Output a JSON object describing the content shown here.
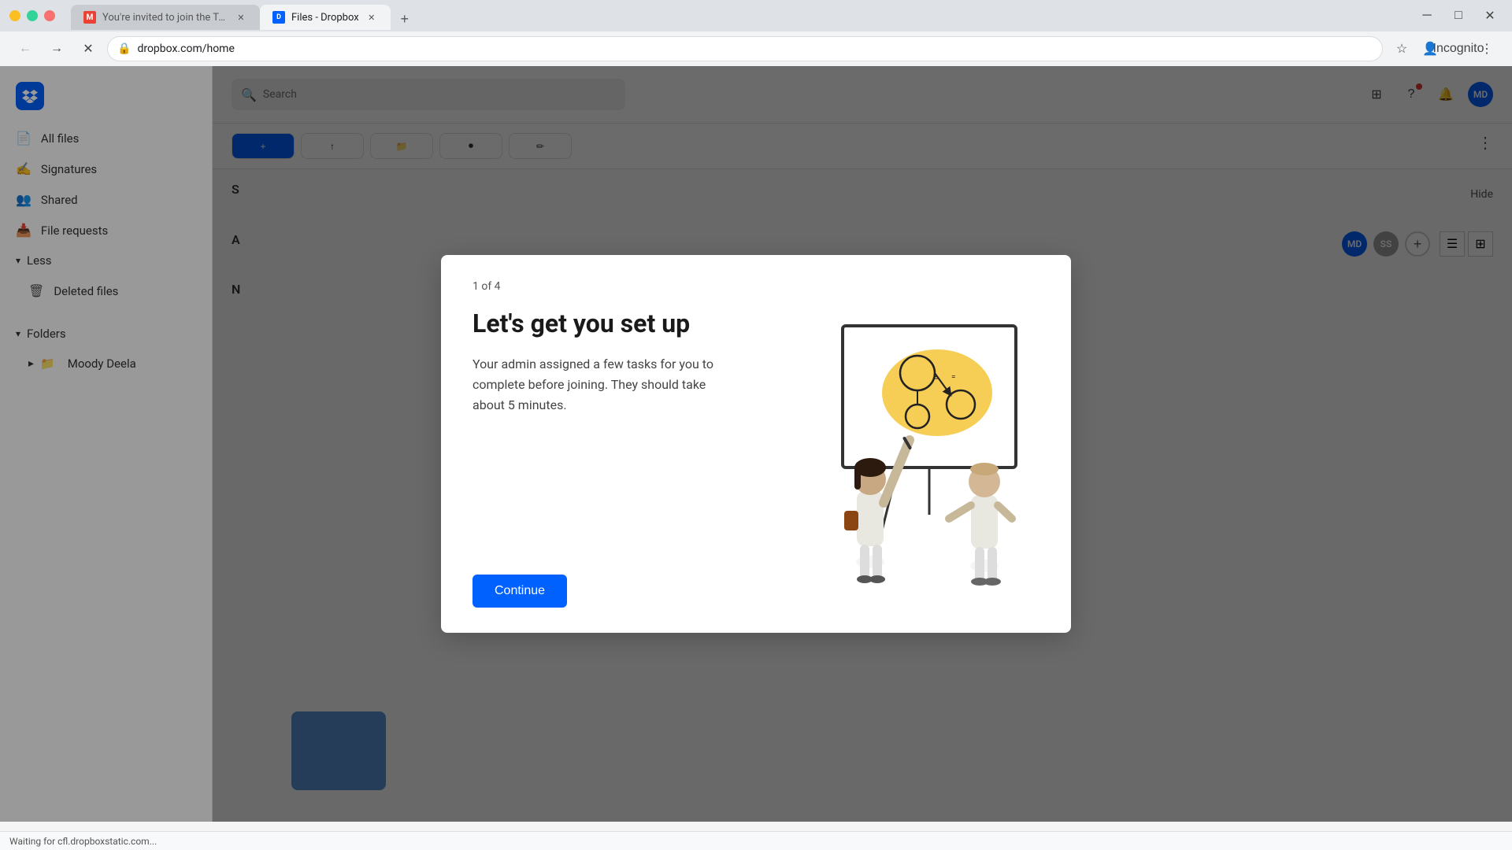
{
  "browser": {
    "tabs": [
      {
        "id": "gmail",
        "title": "You're invited to join the Team...",
        "favicon_type": "gmail",
        "active": false
      },
      {
        "id": "dropbox",
        "title": "Files - Dropbox",
        "favicon_type": "dropbox",
        "active": true
      }
    ],
    "url": "dropbox.com/home",
    "incognito_label": "Incognito"
  },
  "sidebar": {
    "all_files_label": "All files",
    "signatures_label": "Signatures",
    "shared_label": "Shared",
    "file_requests_label": "File requests",
    "less_label": "Less",
    "deleted_files_label": "Deleted files",
    "folders_label": "Folders",
    "moody_deela_label": "Moody Deela"
  },
  "content": {
    "search_placeholder": "Search",
    "hide_label": "Hide",
    "toolbar": {
      "new_label": "+",
      "upload_label": "↑",
      "folder_label": "📁",
      "record_label": "⏺",
      "edit_label": "✏"
    },
    "sections": {
      "suggested_label": "S",
      "all_files_label": "A",
      "new_label": "N"
    }
  },
  "modal": {
    "counter": "1 of 4",
    "title": "Let's get you set up",
    "description": "Your admin assigned a few tasks for you to complete before joining. They should take about 5 minutes.",
    "continue_label": "Continue"
  },
  "avatars": {
    "md_label": "MD",
    "ss_label": "SS"
  },
  "status_bar": {
    "text": "Waiting for cfl.dropboxstatic.com..."
  }
}
